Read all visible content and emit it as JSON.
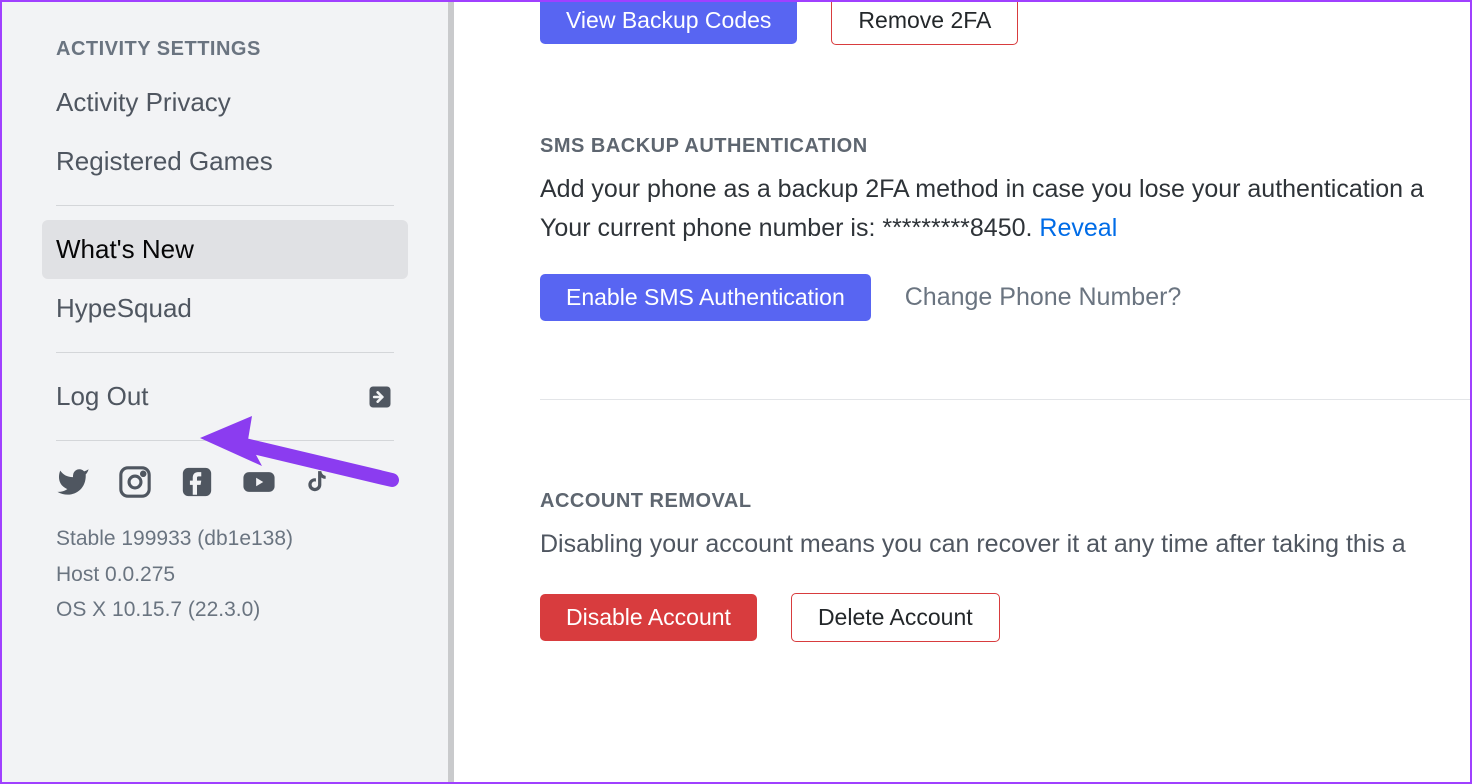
{
  "sidebar": {
    "section_header": "Activity Settings",
    "items": [
      {
        "label": "Activity Privacy"
      },
      {
        "label": "Registered Games"
      }
    ],
    "misc_items": [
      {
        "label": "What's New",
        "selected": true
      },
      {
        "label": "HypeSquad",
        "selected": false
      }
    ],
    "logout_label": "Log Out",
    "version_lines": [
      "Stable 199933 (db1e138)",
      "Host 0.0.275",
      "OS X 10.15.7 (22.3.0)"
    ]
  },
  "main": {
    "top_buttons": {
      "view_backup": "View Backup Codes",
      "remove_2fa": "Remove 2FA"
    },
    "sms": {
      "title": "SMS Backup Authentication",
      "desc_prefix": "Add your phone as a backup 2FA method in case you lose your authentication a",
      "phone_prefix": "Your current phone number is: ",
      "phone_masked": "*********8450.",
      "reveal": "Reveal",
      "enable_btn": "Enable SMS Authentication",
      "change_phone": "Change Phone Number?"
    },
    "removal": {
      "title": "Account Removal",
      "desc": "Disabling your account means you can recover it at any time after taking this a",
      "disable_btn": "Disable Account",
      "delete_btn": "Delete Account"
    }
  }
}
